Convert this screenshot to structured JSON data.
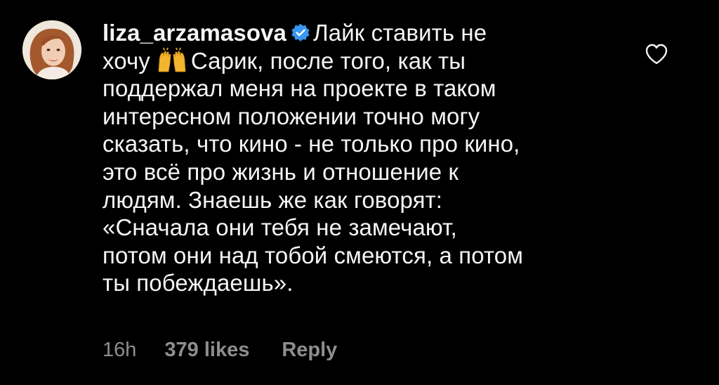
{
  "comment": {
    "username": "liza_arzamasova",
    "verified_icon": "verified-badge-icon",
    "verified_color": "#3897f0",
    "emoji_icon": "raising-hands-emoji",
    "text_lines": [
      "Лайк ставить не",
      "хочу",
      "Сарик, после того, как ты",
      "поддержал меня на проекте в таком",
      "интересном положении точно могу",
      "сказать, что кино - не только про кино,",
      "это всё про жизнь и отношение к",
      "людям. Знаешь же как говорят:",
      "«Сначала они тебя не замечают,",
      "потом они над тобой смеются, а потом",
      "ты побеждаешь»."
    ],
    "time": "16h",
    "likes": "379 likes",
    "reply": "Reply",
    "like_icon": "heart-outline-icon"
  },
  "colors": {
    "background": "#000000",
    "text": "#f5f5f5",
    "meta_text": "#8e8e8e"
  }
}
